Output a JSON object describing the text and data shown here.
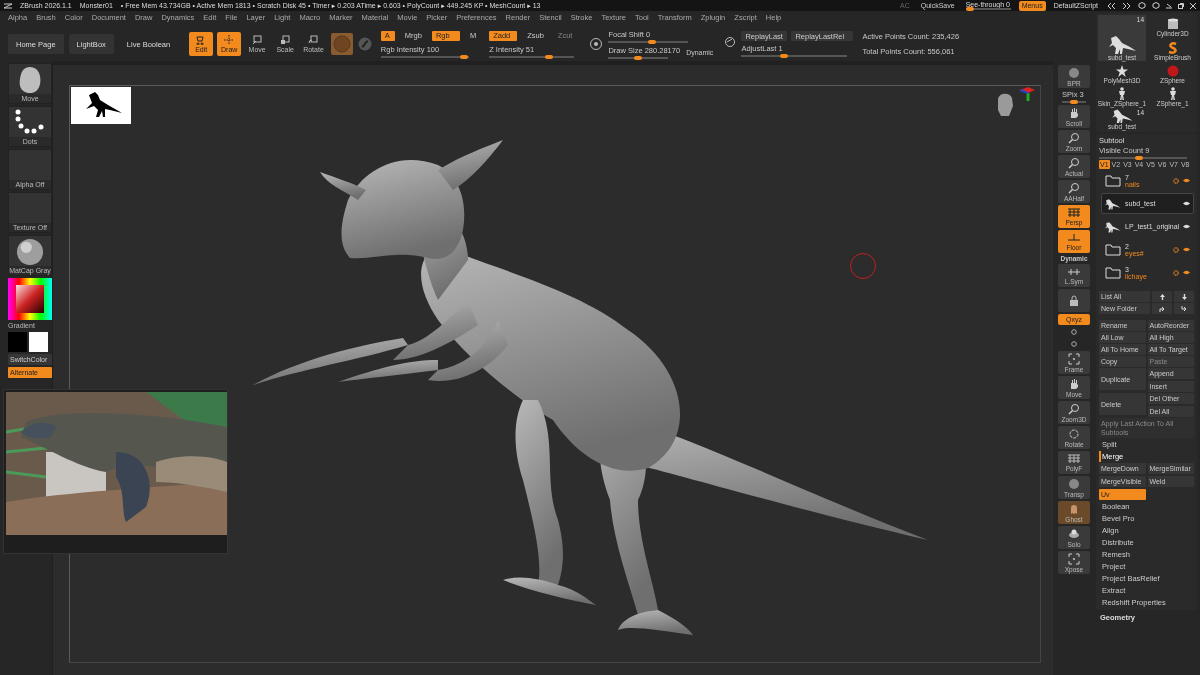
{
  "title_bar": {
    "app": "ZBrush 2026.1.1",
    "file": "Monster01",
    "stats": "• Free Mem 43.734GB • Active Mem 1813 • Scratch Disk 45 •  Timer ▸ 0.203 ATime ▸ 0.603 • PolyCount ▸ 449.245 KP • MeshCount ▸ 13",
    "ac": "AC",
    "quicksave": "QuickSave",
    "see_through": {
      "label": "See-through  0",
      "level": 0
    },
    "menus": {
      "label": "Menus",
      "on": true
    },
    "script": "DefaultZScript"
  },
  "menu": [
    "Alpha",
    "Brush",
    "Color",
    "Document",
    "Draw",
    "Dynamics",
    "Edit",
    "File",
    "Layer",
    "Light",
    "Macro",
    "Marker",
    "Material",
    "Movie",
    "Picker",
    "Preferences",
    "Render",
    "Stencil",
    "Stroke",
    "Texture",
    "Tool",
    "Transform",
    "Zplugin",
    "Zscript",
    "Help"
  ],
  "toolbar": {
    "nav": [
      "Home Page",
      "LightBox",
      "Live Boolean"
    ],
    "modes": [
      {
        "kind": "edit",
        "label": "Edit",
        "selected": true
      },
      {
        "kind": "draw",
        "label": "Draw",
        "selected": true
      },
      {
        "kind": "move",
        "label": "Move",
        "selected": false
      },
      {
        "kind": "scale",
        "label": "Scale",
        "selected": false
      },
      {
        "kind": "rotate",
        "label": "Rotate",
        "selected": false
      }
    ],
    "channels": [
      {
        "label": "A",
        "on": true
      },
      {
        "label": "Mrgb",
        "on": false
      },
      {
        "label": "Rgb",
        "on": true
      },
      {
        "label": "M",
        "on": false
      }
    ],
    "rgb_intensity": {
      "label": "Rgb Intensity 100",
      "level": 0.95
    },
    "zmodes": [
      {
        "label": "Zadd",
        "on": true,
        "disabled": false
      },
      {
        "label": "Zsub",
        "on": false,
        "disabled": false
      },
      {
        "label": "Zcut",
        "on": false,
        "disabled": true
      }
    ],
    "z_intensity": {
      "label": "Z Intensity 51",
      "level": 0.7
    },
    "focal_shift": {
      "label": "Focal Shift 0",
      "level": 0.55
    },
    "draw_size": {
      "label": "Draw Size 280.28170",
      "level": 0.5
    },
    "dynamic": "Dynamic",
    "replay": [
      "ReplayLast",
      "ReplayLastRel"
    ],
    "adjust_last": {
      "label": "AdjustLast 1",
      "level": 0.4
    },
    "counts": [
      "Active Points Count: 235,426",
      "Total Points Count: 556,061"
    ]
  },
  "left_shelf": {
    "tiles": [
      {
        "kind": "brush",
        "label": "Move"
      },
      {
        "kind": "stroke",
        "label": "Dots"
      },
      {
        "kind": "empty",
        "label": "Alpha Off"
      },
      {
        "kind": "empty",
        "label": "Texture Off"
      },
      {
        "kind": "matcap",
        "label": "MatCap Gray"
      }
    ],
    "gradient": "Gradient",
    "switch_color": "SwitchColor",
    "alternate": {
      "label": "Alternate",
      "on": true
    }
  },
  "right_shelf": [
    {
      "kind": "sphere",
      "label": "BPR",
      "on": false
    },
    {
      "kind": "slider",
      "label": "SPix 3",
      "level": 0.5
    },
    {
      "kind": "hand",
      "label": "Scroll",
      "on": false
    },
    {
      "kind": "zoom",
      "label": "Zoom",
      "on": false
    },
    {
      "kind": "zoom",
      "label": "Actual",
      "on": false
    },
    {
      "kind": "zoom",
      "label": "AAHalf",
      "on": false
    },
    {
      "kind": "grid",
      "label": "Persp",
      "on": true
    },
    {
      "kind": "floor",
      "label": "Floor",
      "on": true
    },
    {
      "kind": "label",
      "label": "Dynamic"
    },
    {
      "kind": "sym",
      "label": "L.Sym",
      "on": false
    },
    {
      "kind": "lock",
      "on": false
    },
    {
      "kind": "text",
      "label": "Qxyz",
      "on": true
    },
    {
      "kind": "small"
    },
    {
      "kind": "small"
    },
    {
      "kind": "frame",
      "label": "Frame",
      "on": false
    },
    {
      "kind": "hand",
      "label": "Move",
      "on": false
    },
    {
      "kind": "zoom",
      "label": "Zoom3D",
      "on": false
    },
    {
      "kind": "rotate",
      "label": "Rotate",
      "on": false
    },
    {
      "kind": "grid",
      "label": "PolyF",
      "on": false
    },
    {
      "kind": "sphere",
      "label": "Transp",
      "on": false
    },
    {
      "kind": "ghost",
      "label": "Ghost",
      "on": false
    },
    {
      "kind": "solo",
      "label": "Solo",
      "on": false
    },
    {
      "kind": "frame",
      "label": "Xpose",
      "on": false
    }
  ],
  "tools": [
    {
      "kind": "creature",
      "name": "subd_test",
      "count": "14"
    },
    {
      "kind": "cylinder",
      "name": "Cylinder3D"
    },
    {
      "kind": "brush",
      "name": "SimpleBrush"
    },
    {
      "kind": "star",
      "name": "PolyMesh3D"
    },
    {
      "kind": "sphere",
      "name": "ZSphere"
    },
    {
      "kind": "figure",
      "name": "Skin_ZSphere_1"
    },
    {
      "kind": "figure",
      "name": "ZSphere_1"
    },
    {
      "kind": "creature",
      "name": "subd_test",
      "count": "14"
    }
  ],
  "subtool": {
    "title": "Subtool",
    "visible_count": {
      "label": "Visible Count 9",
      "level": 0.45
    },
    "versions": [
      {
        "label": "V1",
        "selected": true
      },
      {
        "label": "V2",
        "selected": false
      },
      {
        "label": "V3",
        "selected": false
      },
      {
        "label": "V4",
        "selected": false
      },
      {
        "label": "V5",
        "selected": false
      },
      {
        "label": "V6",
        "selected": false
      },
      {
        "label": "V7",
        "selected": false
      },
      {
        "label": "V8",
        "selected": false
      }
    ],
    "items": [
      {
        "kind": "folder",
        "number": "7",
        "name": "nails",
        "selected": false
      },
      {
        "kind": "mesh",
        "name": "subd_test",
        "selected": true
      },
      {
        "kind": "mesh",
        "name": "LP_test1_original",
        "selected": false
      },
      {
        "kind": "folder",
        "number": "2",
        "name": "eyes#",
        "selected": false
      },
      {
        "kind": "folder",
        "number": "3",
        "name": "lichaye",
        "selected": false
      }
    ],
    "list_all": "List All",
    "new_folder": "New Folder",
    "actions": [
      {
        "kind": "pair",
        "items": [
          {
            "label": "Rename",
            "disabled": false
          },
          {
            "label": "AutoReorder",
            "disabled": false
          }
        ]
      },
      {
        "kind": "pair",
        "items": [
          {
            "label": "All Low",
            "disabled": false
          },
          {
            "label": "All High",
            "disabled": false
          }
        ]
      },
      {
        "kind": "pair",
        "items": [
          {
            "label": "All To Home",
            "disabled": false
          },
          {
            "label": "All To Target",
            "disabled": false
          }
        ]
      },
      {
        "kind": "pair",
        "items": [
          {
            "label": "Copy",
            "disabled": false
          },
          {
            "label": "Paste",
            "disabled": true
          }
        ]
      },
      {
        "kind": "tall",
        "label": "Duplicate",
        "items": [
          {
            "label": "Append",
            "disabled": false
          },
          {
            "label": "Insert",
            "disabled": false
          }
        ]
      },
      {
        "kind": "tall",
        "label": "Delete",
        "items": [
          {
            "label": "Del Other",
            "disabled": false
          },
          {
            "label": "Del All",
            "disabled": false
          }
        ]
      }
    ],
    "apply_all": {
      "label": "Apply Last Action To All Subtools",
      "disabled": true
    },
    "sections": [
      {
        "label": "Split",
        "expanded": false
      },
      {
        "label": "Merge",
        "expanded": true,
        "buttons": [
          {
            "label": "MergeDown",
            "on": false
          },
          {
            "label": "MergeSimilar",
            "on": false
          },
          {
            "label": "MergeVisible",
            "on": false
          },
          {
            "label": "Weld",
            "on": false
          },
          {
            "label": "Uv",
            "on": true
          }
        ]
      },
      {
        "label": "Boolean",
        "expanded": false
      },
      {
        "label": "Bevel Pro",
        "expanded": false
      },
      {
        "label": "Align",
        "expanded": false
      },
      {
        "label": "Distribute",
        "expanded": false
      },
      {
        "label": "Remesh",
        "expanded": false
      },
      {
        "label": "Project",
        "expanded": false
      },
      {
        "label": "Project BasRelief",
        "expanded": false
      },
      {
        "label": "Extract",
        "expanded": false
      },
      {
        "label": "Redshift Properties",
        "expanded": false
      }
    ]
  },
  "palettes": [
    "Geometry"
  ]
}
